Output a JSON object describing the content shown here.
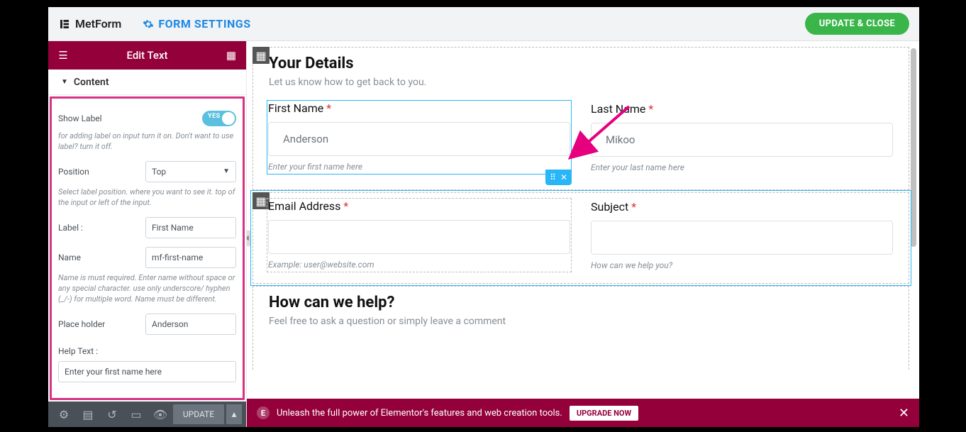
{
  "topbar": {
    "brand": "MetForm",
    "form_settings": "FORM SETTINGS",
    "update_close": "UPDATE & CLOSE"
  },
  "sidebar": {
    "title": "Edit Text",
    "accordion": "Content",
    "show_label_label": "Show Label",
    "show_label_toggle": "YES",
    "show_label_help": "for adding label on input turn it on. Don't want to use label? turn it off.",
    "position_label": "Position",
    "position_value": "Top",
    "position_help": "Select label position. where you want to see it. top of the input or left of the input.",
    "label_label": "Label :",
    "label_value": "First Name",
    "name_label": "Name",
    "name_value": "mf-first-name",
    "name_help": "Name is must required. Enter name without space or any special character. use only underscore/ hyphen (_/-) for multiple word. Name must be different.",
    "placeholder_label": "Place holder",
    "placeholder_value": "Anderson",
    "helptext_label": "Help Text :",
    "helptext_value": "Enter your first name here",
    "footer_update": "UPDATE"
  },
  "canvas": {
    "sec1_title": "Your Details",
    "sec1_sub": "Let us know how to get back to you.",
    "first_name_label": "First Name",
    "first_name_placeholder": "Anderson",
    "first_name_help": "Enter your first name here",
    "last_name_label": "Last Name",
    "last_name_placeholder": "Mikoo",
    "last_name_help": "Enter your last name here",
    "email_label": "Email Address",
    "email_help": "Example: user@website.com",
    "subject_label": "Subject",
    "subject_help": "How can we help you?",
    "sec2_title": "How can we help?",
    "sec2_sub": "Feel free to ask a question or simply leave a comment"
  },
  "promo": {
    "text": "Unleash the full power of Elementor's features and web creation tools.",
    "cta": "UPGRADE NOW"
  }
}
